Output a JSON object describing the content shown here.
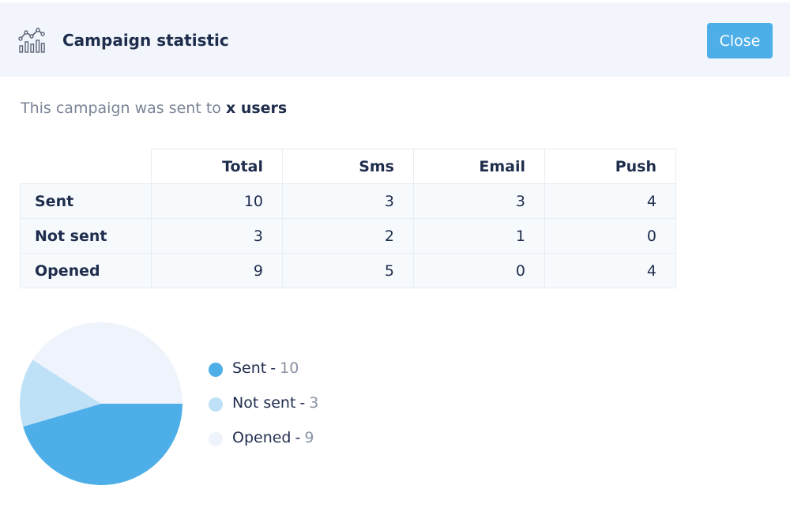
{
  "header": {
    "title": "Campaign statistic",
    "icon": "chart-stats-icon",
    "close_label": "Close"
  },
  "intro": {
    "prefix": "This campaign was sent to ",
    "bold": "x users"
  },
  "table": {
    "columns": [
      "Total",
      "Sms",
      "Email",
      "Push"
    ],
    "rows": [
      {
        "label": "Sent",
        "values": [
          "10",
          "3",
          "3",
          "4"
        ]
      },
      {
        "label": "Not sent",
        "values": [
          "3",
          "2",
          "1",
          "0"
        ]
      },
      {
        "label": "Opened",
        "values": [
          "9",
          "5",
          "0",
          "4"
        ]
      }
    ]
  },
  "chart_data": {
    "type": "pie",
    "categories": [
      "Sent",
      "Not sent",
      "Opened"
    ],
    "values": [
      10,
      3,
      9
    ],
    "colors": [
      "#4daee8",
      "#bfe1f7",
      "#eff3fb"
    ],
    "title": "",
    "legend_position": "right"
  },
  "legend": {
    "separator": "-",
    "items": [
      {
        "label": "Sent",
        "value": "10",
        "color": "#4daee8"
      },
      {
        "label": "Not sent",
        "value": "3",
        "color": "#bfe1f7"
      },
      {
        "label": "Opened",
        "value": "9",
        "color": "#eff3fb"
      }
    ]
  },
  "colors": {
    "accent": "#4daee8",
    "header_bg": "#f2f6fc",
    "text_dark": "#1f2d4d",
    "text_muted": "#7a8496"
  }
}
